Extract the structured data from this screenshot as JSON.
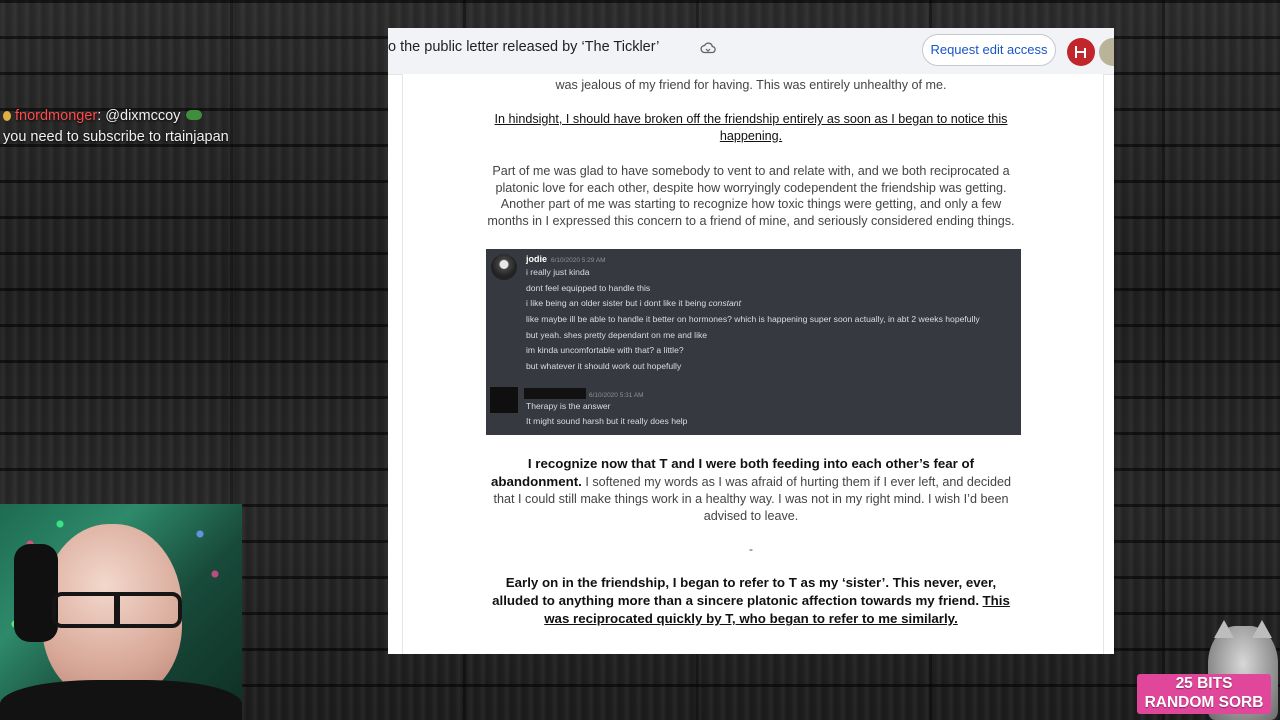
{
  "chat": {
    "username": "fnordmonger",
    "mention": "@dixmccoy",
    "message": "you need to subscribe to rtainjapan"
  },
  "doc": {
    "title": "o the public letter released by ‘The Tickler’",
    "request_edit_label": "Request edit access",
    "paragraphs": {
      "p0": "was jealous of my friend for having. This was entirely unhealthy of me.",
      "p1": "In hindsight, I should have broken off the friendship entirely as soon as I began to notice this happening.",
      "p2": "Part of me was glad to have somebody to vent to and relate with, and we both reciprocated a platonic love for each other, despite how worryingly codependent the friendship was getting. Another part of me was starting to recognize how toxic things were getting, and only a few months in I expressed this concern to a friend of mine, and seriously considered ending things.",
      "p3_bold": "I recognize now that T and I were both feeding into each other’s fear of abandonment.",
      "p3_rest": " I softened my words as I was afraid of hurting them if I ever left, and decided that I could still make things work in a healthy way. I was not in my right mind. I wish I’d been advised to leave.",
      "dash": "-",
      "p4_bold": "Early on in the friendship, I began to refer to T as my ‘sister’. This never, ever, alluded to anything more than a sincere platonic affection towards my friend.",
      "p4_underline": "This was reciprocated quickly by T, who began to refer to me similarly."
    }
  },
  "discord": {
    "user1": "jodie",
    "ts1": "6/10/2020 5:29 AM",
    "lines1": [
      "i really just kinda",
      "dont feel equipped to handle this",
      "i like being an older sister but i dont like it being ",
      "like maybe ill be able to handle it better on hormones? which is happening super soon actually, in abt 2 weeks hopefully",
      "but yeah. shes pretty dependant on me and like",
      "im kinda uncomfortable with that? a little?",
      "but whatever it should work out hopefully"
    ],
    "constant_word": "constant",
    "ts2": "6/10/2020 5:31 AM",
    "lines2": [
      "Therapy is the answer",
      "It might sound harsh but it really does help"
    ]
  },
  "overlay": {
    "bits_line1": "25 BITS",
    "bits_line2": "RANDOM SORB"
  },
  "colors": {
    "chat_name": "#ff4b4b",
    "link_blue": "#1a56c4",
    "discord_bg": "#36393f",
    "bits_bg": "#e0479a"
  }
}
